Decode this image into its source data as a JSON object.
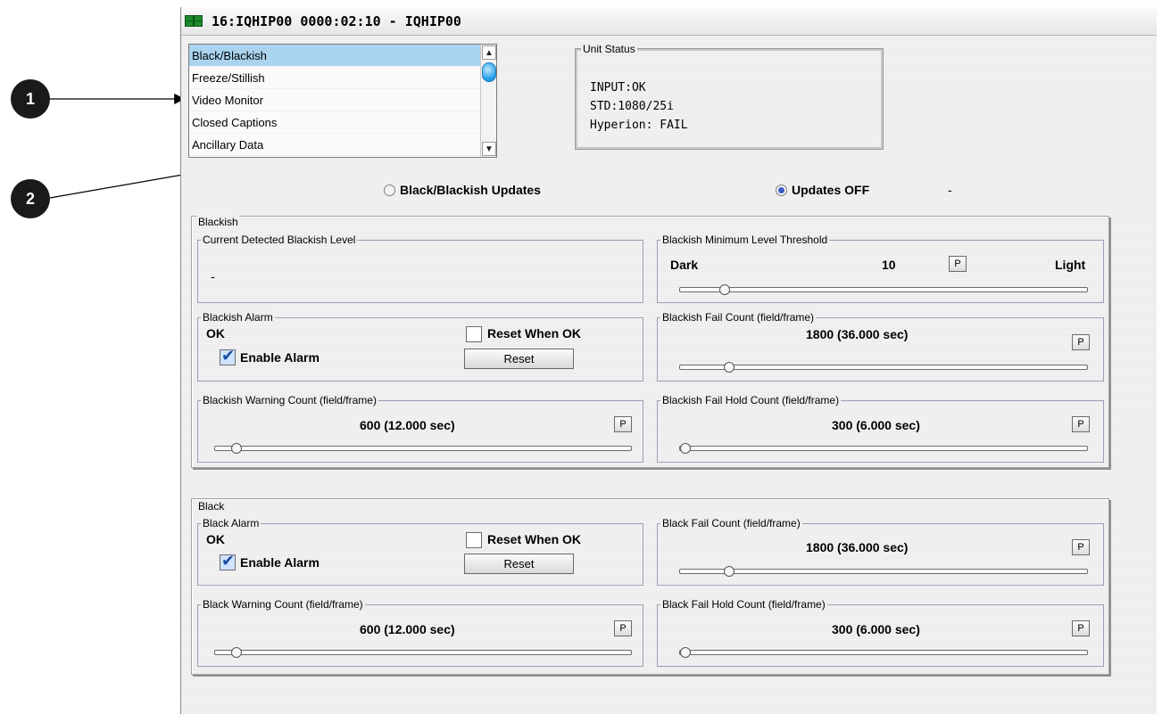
{
  "window": {
    "title": "16:IQHIP00  0000:02:10  - IQHIP00"
  },
  "list": {
    "items": [
      "Black/Blackish",
      "Freeze/Stillish",
      "Video Monitor",
      "Closed Captions",
      "Ancillary Data"
    ],
    "selected": "Black/Blackish"
  },
  "unit_status": {
    "label": "Unit Status",
    "lines": [
      "INPUT:OK",
      "STD:1080/25i",
      "Hyperion: FAIL"
    ]
  },
  "radios": {
    "option1": "Black/Blackish Updates",
    "option2": "Updates OFF",
    "selected": "Updates OFF",
    "trailing": "-"
  },
  "callouts": {
    "one": "1",
    "two": "2"
  },
  "blackish": {
    "label": "Blackish",
    "current_level": {
      "label": "Current Detected Blackish Level",
      "value": "-"
    },
    "min_threshold": {
      "label": "Blackish Minimum Level Threshold",
      "left": "Dark",
      "value": "10",
      "right": "Light",
      "p": "P",
      "level": 0.1
    },
    "alarm": {
      "label": "Blackish Alarm",
      "status": "OK",
      "reset_when_ok": "Reset When OK",
      "enable_alarm": "Enable Alarm",
      "reset": "Reset",
      "reset_when_ok_checked": false,
      "enable_checked": true
    },
    "fail_count": {
      "label": "Blackish Fail Count (field/frame)",
      "value": "1800 (36.000 sec)",
      "p": "P",
      "level": 0.11
    },
    "warning_count": {
      "label": "Blackish Warning Count (field/frame)",
      "value": "600 (12.000 sec)",
      "p": "P",
      "level": 0.04
    },
    "fail_hold_count": {
      "label": "Blackish Fail Hold Count (field/frame)",
      "value": "300 (6.000 sec)",
      "p": "P",
      "level": 0.0
    }
  },
  "black": {
    "label": "Black",
    "alarm": {
      "label": "Black Alarm",
      "status": "OK",
      "reset_when_ok": "Reset When OK",
      "enable_alarm": "Enable Alarm",
      "reset": "Reset",
      "reset_when_ok_checked": false,
      "enable_checked": true
    },
    "fail_count": {
      "label": "Black Fail Count (field/frame)",
      "value": "1800 (36.000 sec)",
      "p": "P",
      "level": 0.11
    },
    "warning_count": {
      "label": "Black Warning Count (field/frame)",
      "value": "600 (12.000 sec)",
      "p": "P",
      "level": 0.04
    },
    "fail_hold_count": {
      "label": "Black Fail Hold Count (field/frame)",
      "value": "300 (6.000 sec)",
      "p": "P",
      "level": 0.0
    }
  }
}
